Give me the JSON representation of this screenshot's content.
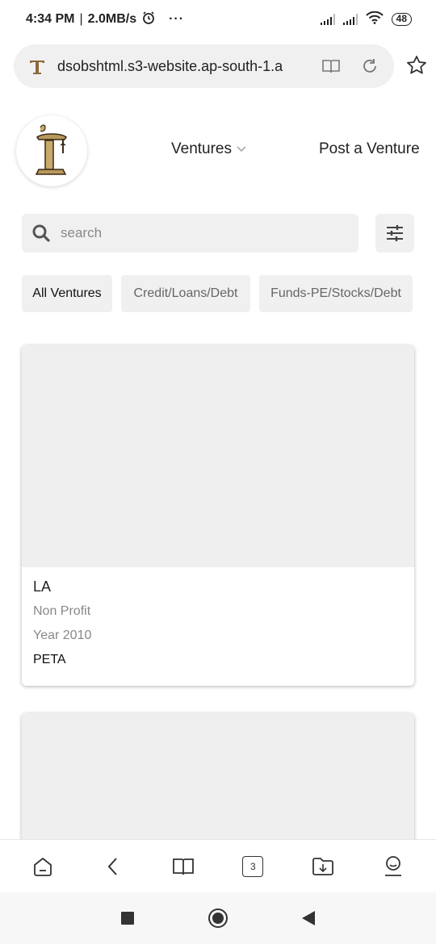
{
  "status_bar": {
    "time": "4:34 PM",
    "separator": "|",
    "speed": "2.0MB/s",
    "more": "···",
    "battery": "48",
    "icons": [
      "alarm-icon",
      "signal-icon",
      "signal-icon",
      "wifi-icon",
      "battery-icon"
    ]
  },
  "browser": {
    "url": "dsobshtml.s3-website.ap-south-1.a",
    "icons": [
      "site-favicon",
      "reader-icon",
      "reload-icon",
      "star-icon"
    ]
  },
  "header": {
    "nav_ventures": "Ventures",
    "nav_post": "Post a Venture"
  },
  "search": {
    "placeholder": "search",
    "value": ""
  },
  "tabs": [
    {
      "label": "All Ventures",
      "active": true
    },
    {
      "label": "Credit/Loans/Debt",
      "active": false
    },
    {
      "label": "Funds-PE/Stocks/Debt",
      "active": false
    }
  ],
  "cards": [
    {
      "title": "LA",
      "category": "Non Profit",
      "year": "Year 2010",
      "org": "PETA"
    }
  ],
  "toolbar": {
    "tab_count": "3",
    "icons": [
      "home-icon",
      "back-icon",
      "bookmarks-icon",
      "tabs-icon",
      "downloads-icon",
      "profile-icon"
    ]
  },
  "colors": {
    "surface": "#f0f0f0",
    "text": "#222222",
    "muted": "#888888"
  }
}
